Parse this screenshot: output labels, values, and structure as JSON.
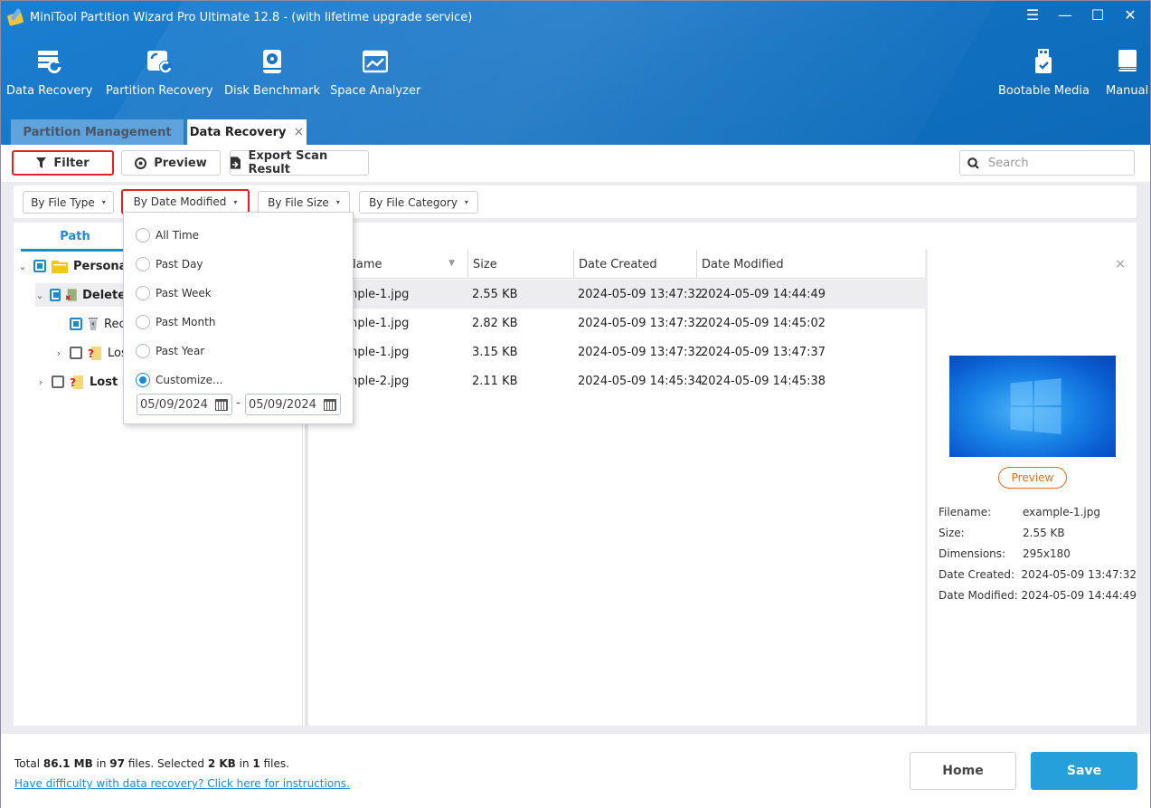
{
  "window": {
    "title": "MiniTool Partition Wizard Pro Ultimate 12.8 - (with lifetime upgrade service)",
    "controls": [
      "menu-icon",
      "minimize-icon",
      "maximize-icon",
      "close-icon"
    ]
  },
  "toolbar": {
    "items": [
      {
        "label": "Data Recovery",
        "icon": "data-recovery-icon"
      },
      {
        "label": "Partition Recovery",
        "icon": "partition-recovery-icon"
      },
      {
        "label": "Disk Benchmark",
        "icon": "disk-benchmark-icon"
      },
      {
        "label": "Space Analyzer",
        "icon": "space-analyzer-icon"
      },
      {
        "label": "Bootable Media",
        "icon": "bootable-media-icon"
      },
      {
        "label": "Manual",
        "icon": "manual-icon"
      }
    ]
  },
  "tabs": [
    {
      "label": "Partition Management",
      "active": false
    },
    {
      "label": "Data Recovery",
      "active": true,
      "close": "×"
    }
  ],
  "actions": {
    "filter": "Filter",
    "preview": "Preview",
    "export": "Export Scan Result",
    "search_placeholder": "Search"
  },
  "filters": {
    "file_type": "By File Type",
    "date_modified": "By Date Modified",
    "file_size": "By File Size",
    "file_category": "By File Category"
  },
  "date_dropdown": {
    "options": [
      {
        "label": "All Time",
        "selected": false
      },
      {
        "label": "Past Day",
        "selected": false
      },
      {
        "label": "Past Week",
        "selected": false
      },
      {
        "label": "Past Month",
        "selected": false
      },
      {
        "label": "Past Year",
        "selected": false
      },
      {
        "label": "Customize...",
        "selected": true
      }
    ],
    "from_date": "05/09/2024",
    "to_date": "05/09/2024",
    "separator": "-"
  },
  "tree": {
    "tab": "Path",
    "items": [
      {
        "label": "Personal",
        "level": 0,
        "expanded": true,
        "checked": "partial",
        "icon": "folder-icon",
        "bold": true
      },
      {
        "label": "Delete",
        "level": 1,
        "expanded": true,
        "checked": "partial",
        "icon": "deleted-files-icon",
        "bold": true
      },
      {
        "label": "Rec",
        "level": 2,
        "checked": "partial",
        "icon": "recycle-bin-icon",
        "bold": false
      },
      {
        "label": "Los",
        "level": 2,
        "expanded": false,
        "checked": "none",
        "icon": "lost-folder-icon",
        "bold": false
      },
      {
        "label": "Lost F",
        "level": 0,
        "expanded": false,
        "checked": "none",
        "icon": "lost-folder-icon",
        "bold": true
      }
    ]
  },
  "table": {
    "columns": [
      "e Name",
      "Size",
      "Date Created",
      "Date Modified"
    ],
    "rows": [
      {
        "name": "xample-1.jpg",
        "size": "2.55 KB",
        "created": "2024-05-09 13:47:32",
        "modified": "2024-05-09 14:44:49",
        "selected": true
      },
      {
        "name": "xample-1.jpg",
        "size": "2.82 KB",
        "created": "2024-05-09 13:47:32",
        "modified": "2024-05-09 14:45:02",
        "selected": false
      },
      {
        "name": "xample-1.jpg",
        "size": "3.15 KB",
        "created": "2024-05-09 13:47:32",
        "modified": "2024-05-09 13:47:37",
        "selected": false
      },
      {
        "name": "xample-2.jpg",
        "size": "2.11 KB",
        "created": "2024-05-09 14:45:34",
        "modified": "2024-05-09 14:45:38",
        "selected": false
      }
    ]
  },
  "preview": {
    "button": "Preview",
    "close": "×",
    "info": [
      {
        "key": "Filename:",
        "value": "example-1.jpg"
      },
      {
        "key": "Size:",
        "value": "2.55 KB"
      },
      {
        "key": "Dimensions:",
        "value": "295x180"
      },
      {
        "key": "Date Created:",
        "value": "2024-05-09 13:47:32"
      },
      {
        "key": "Date Modified:",
        "value": "2024-05-09 14:44:49"
      }
    ]
  },
  "footer": {
    "total_prefix": "Total ",
    "total_size": "86.1 MB",
    "in1": " in ",
    "total_files": "97",
    "files1": " files.  Selected ",
    "selected_size": "2 KB",
    "in2": " in ",
    "selected_files": "1",
    "files2": " files.",
    "help_link": "Have difficulty with data recovery? Click here for instructions.",
    "home": "Home",
    "save": "Save"
  },
  "colors": {
    "accent": "#1a8ad4",
    "header": "#1875c6",
    "highlight_border": "#e52020",
    "save_button": "#26a0da",
    "preview_button": "#e07020"
  }
}
